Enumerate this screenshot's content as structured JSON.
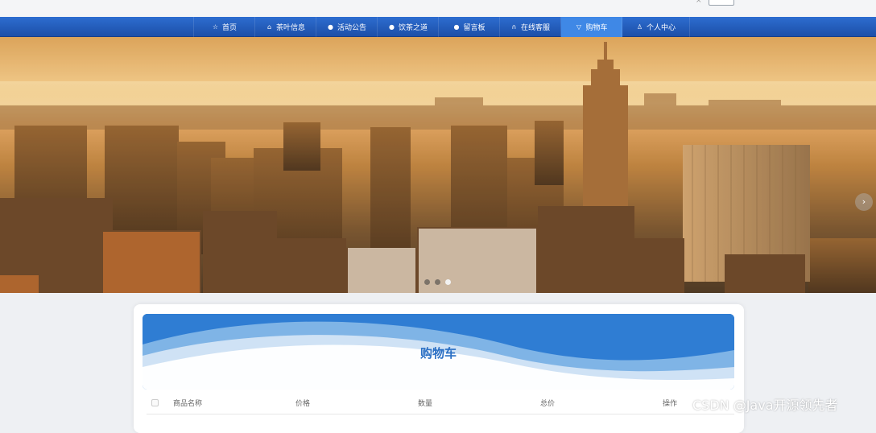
{
  "nav": {
    "items": [
      {
        "label": "首页",
        "icon": "star-icon",
        "glyph": "☆"
      },
      {
        "label": "茶叶信息",
        "icon": "home-icon",
        "glyph": "⌂"
      },
      {
        "label": "活动公告",
        "icon": "info-icon",
        "glyph": "●"
      },
      {
        "label": "饮茶之道",
        "icon": "info-icon",
        "glyph": "●"
      },
      {
        "label": "留言板",
        "icon": "info-icon",
        "glyph": "●"
      },
      {
        "label": "在线客服",
        "icon": "headset-icon",
        "glyph": "∩"
      },
      {
        "label": "购物车",
        "icon": "cart-icon",
        "glyph": "▽",
        "active": true
      },
      {
        "label": "个人中心",
        "icon": "user-icon",
        "glyph": "♙"
      }
    ]
  },
  "banner": {
    "next_glyph": "›",
    "slides": 3,
    "active_slide": 2
  },
  "cart": {
    "title": "购物车",
    "columns": [
      "商品名称",
      "价格",
      "数量",
      "总价",
      "操作"
    ]
  },
  "watermark": "CSDN @Java开源领先者",
  "colors": {
    "nav": "#1f56b4",
    "nav_active": "#3f88e6",
    "accent": "#2a6fc4"
  }
}
